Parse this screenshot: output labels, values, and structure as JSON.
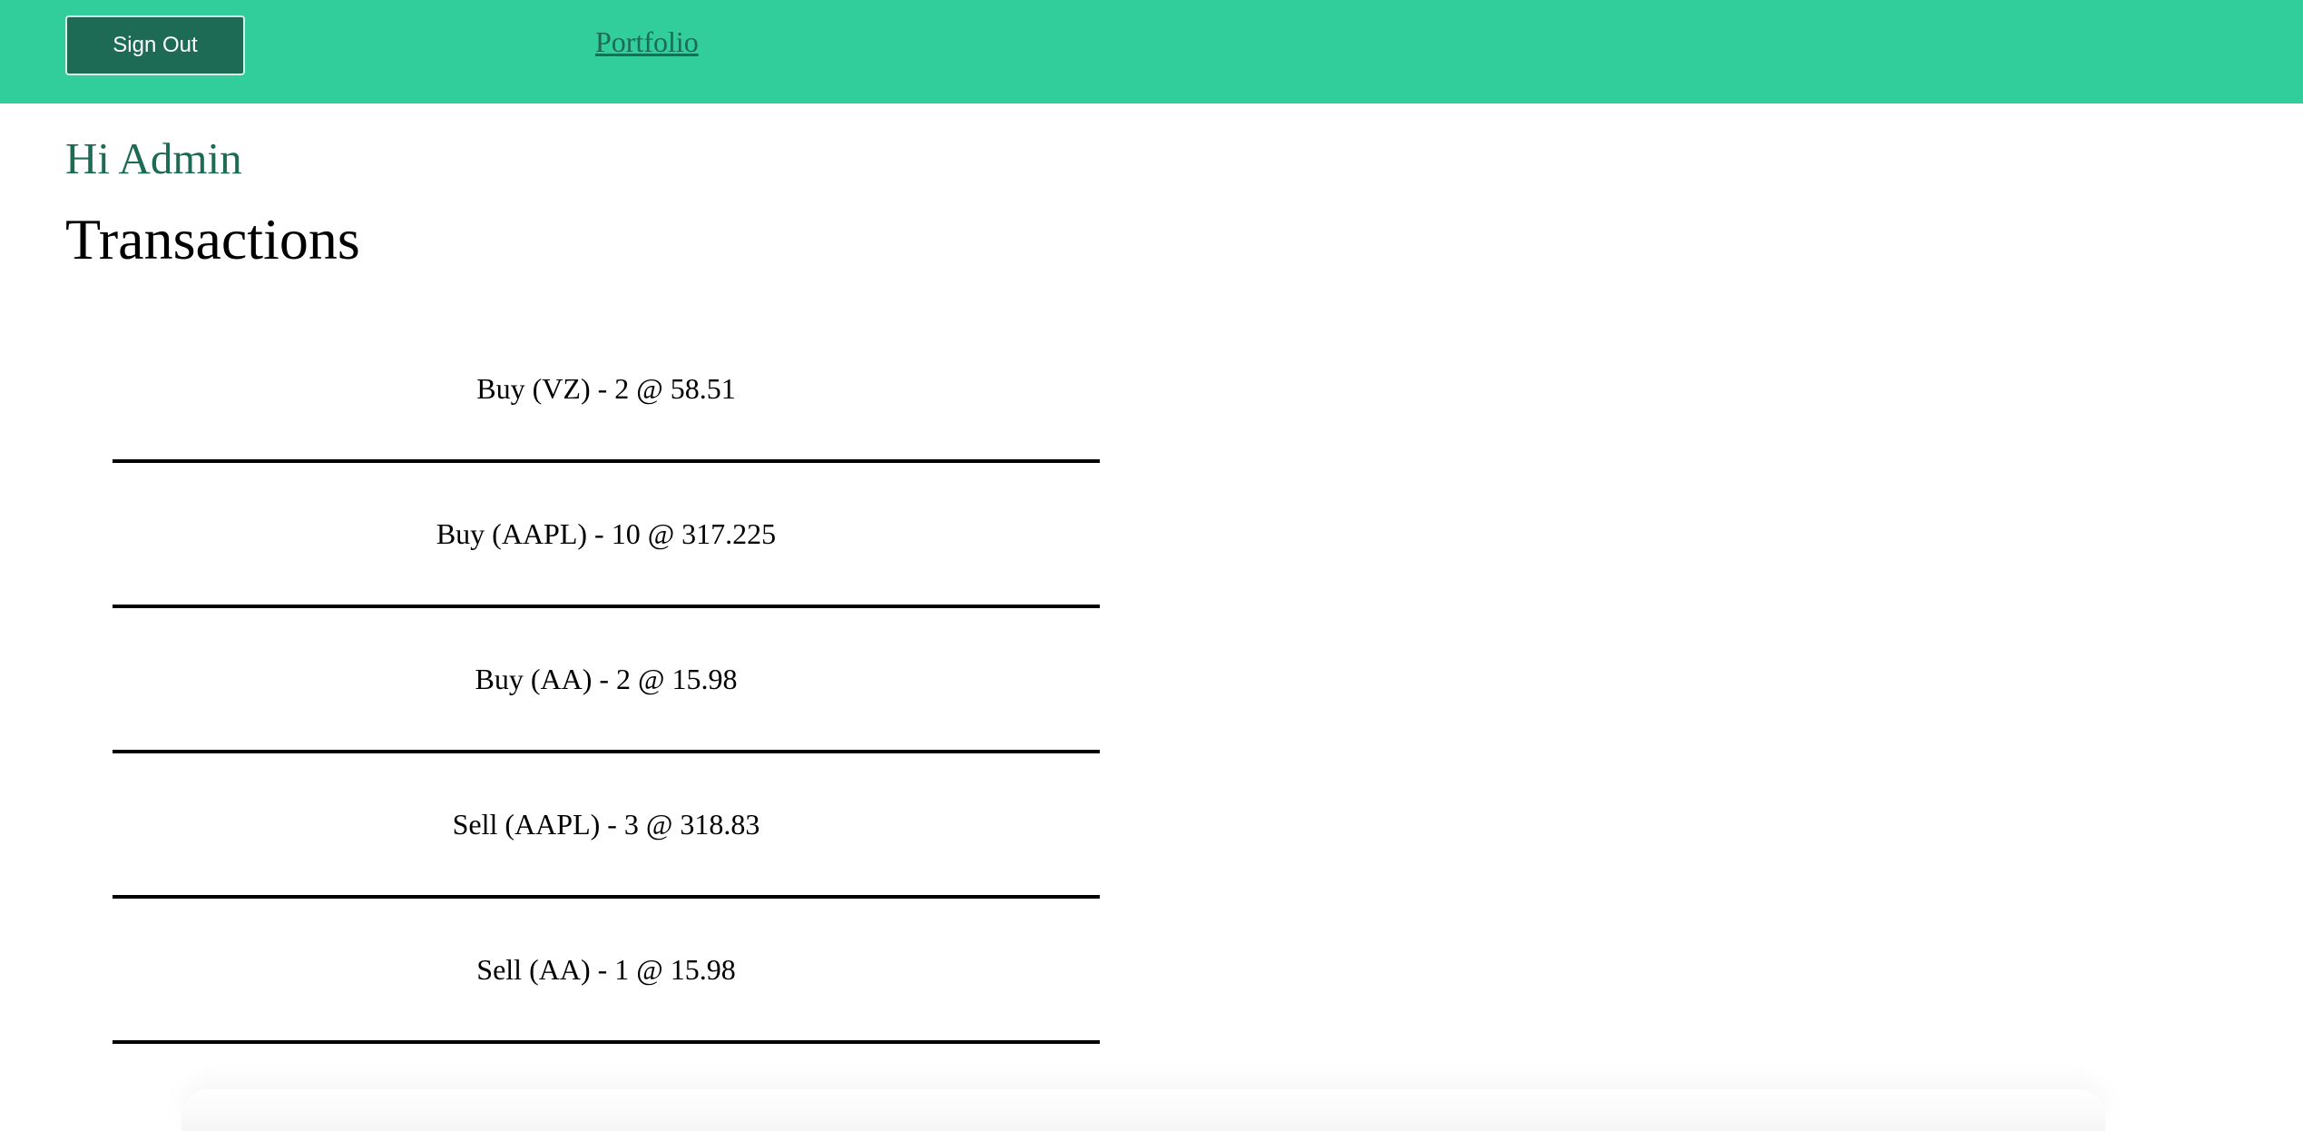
{
  "header": {
    "signout_label": "Sign Out",
    "portfolio_label": "Portfolio"
  },
  "colors": {
    "header_bg": "#31ce9b",
    "accent_dark": "#1e6b55"
  },
  "main": {
    "greeting": "Hi Admin",
    "title": "Transactions",
    "transactions": [
      "Buy (VZ) - 2 @ 58.51",
      "Buy (AAPL) - 10 @ 317.225",
      "Buy (AA) - 2 @ 15.98",
      "Sell (AAPL) - 3 @ 318.83",
      "Sell (AA) - 1 @ 15.98"
    ]
  }
}
